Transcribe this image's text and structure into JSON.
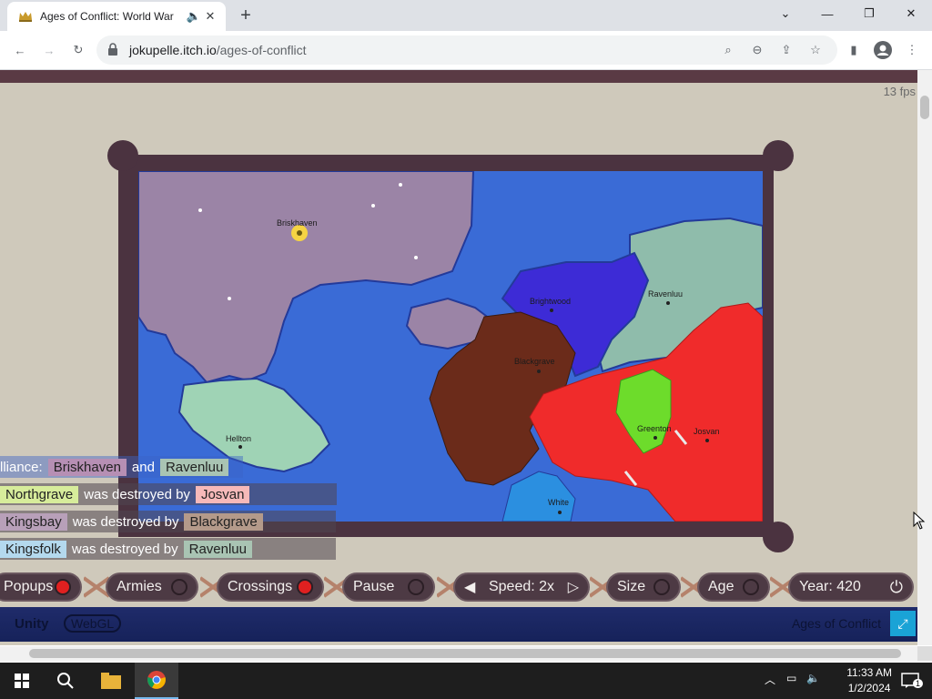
{
  "browser": {
    "tab_title": "Ages of Conflict: World War",
    "url_host": "jokupelle.itch.io",
    "url_path": "/ages-of-conflict",
    "new_tab_label": "+"
  },
  "game": {
    "fps": "13 fps",
    "cities": [
      {
        "name": "Briskhaven"
      },
      {
        "name": "Brightwood"
      },
      {
        "name": "Ravenluu"
      },
      {
        "name": "Blackgrave"
      },
      {
        "name": "Hellton"
      },
      {
        "name": "Greenton"
      },
      {
        "name": "Josvan"
      },
      {
        "name": "White"
      }
    ],
    "notifications": [
      {
        "prefix": "lliance:",
        "a": "Briskhaven",
        "a_color": "#b68fb4",
        "mid": "and",
        "b": "Ravenluu",
        "b_color": "#a9c4b3"
      },
      {
        "prefix": "",
        "a": "Northgrave",
        "a_color": "#d7ec9b",
        "mid": "was destroyed by",
        "b": "Josvan",
        "b_color": "#f6b9b9"
      },
      {
        "prefix": "",
        "a": "Kingsbay",
        "a_color": "#b8a0b9",
        "mid": "was destroyed by",
        "b": "Blackgrave",
        "b_color": "#b49a8a"
      },
      {
        "prefix": "",
        "a": "Kingsfolk",
        "a_color": "#b4d9ee",
        "mid": "was destroyed by",
        "b": "Ravenluu",
        "b_color": "#a9c4b3"
      }
    ],
    "controls": {
      "popups": "Popups",
      "armies": "Armies",
      "crossings": "Crossings",
      "pause": "Pause",
      "speed": "Speed: 2x",
      "size": "Size",
      "age": "Age",
      "year": "Year: 420"
    },
    "footer": {
      "unity": "Unity",
      "webgl": "WebGL",
      "game_name": "Ages of Conflict"
    }
  },
  "taskbar": {
    "time": "11:33 AM",
    "date": "1/2/2024",
    "notification_count": "1"
  },
  "colors": {
    "ocean": "#3a6bd6",
    "purple_nation": "#9b84a6",
    "brown_nation": "#6b2b1a",
    "red_nation": "#f02b2b",
    "teal_nation": "#8fbcab",
    "indigo_nation": "#3d2bd6",
    "green_nation": "#6ddc2b"
  }
}
